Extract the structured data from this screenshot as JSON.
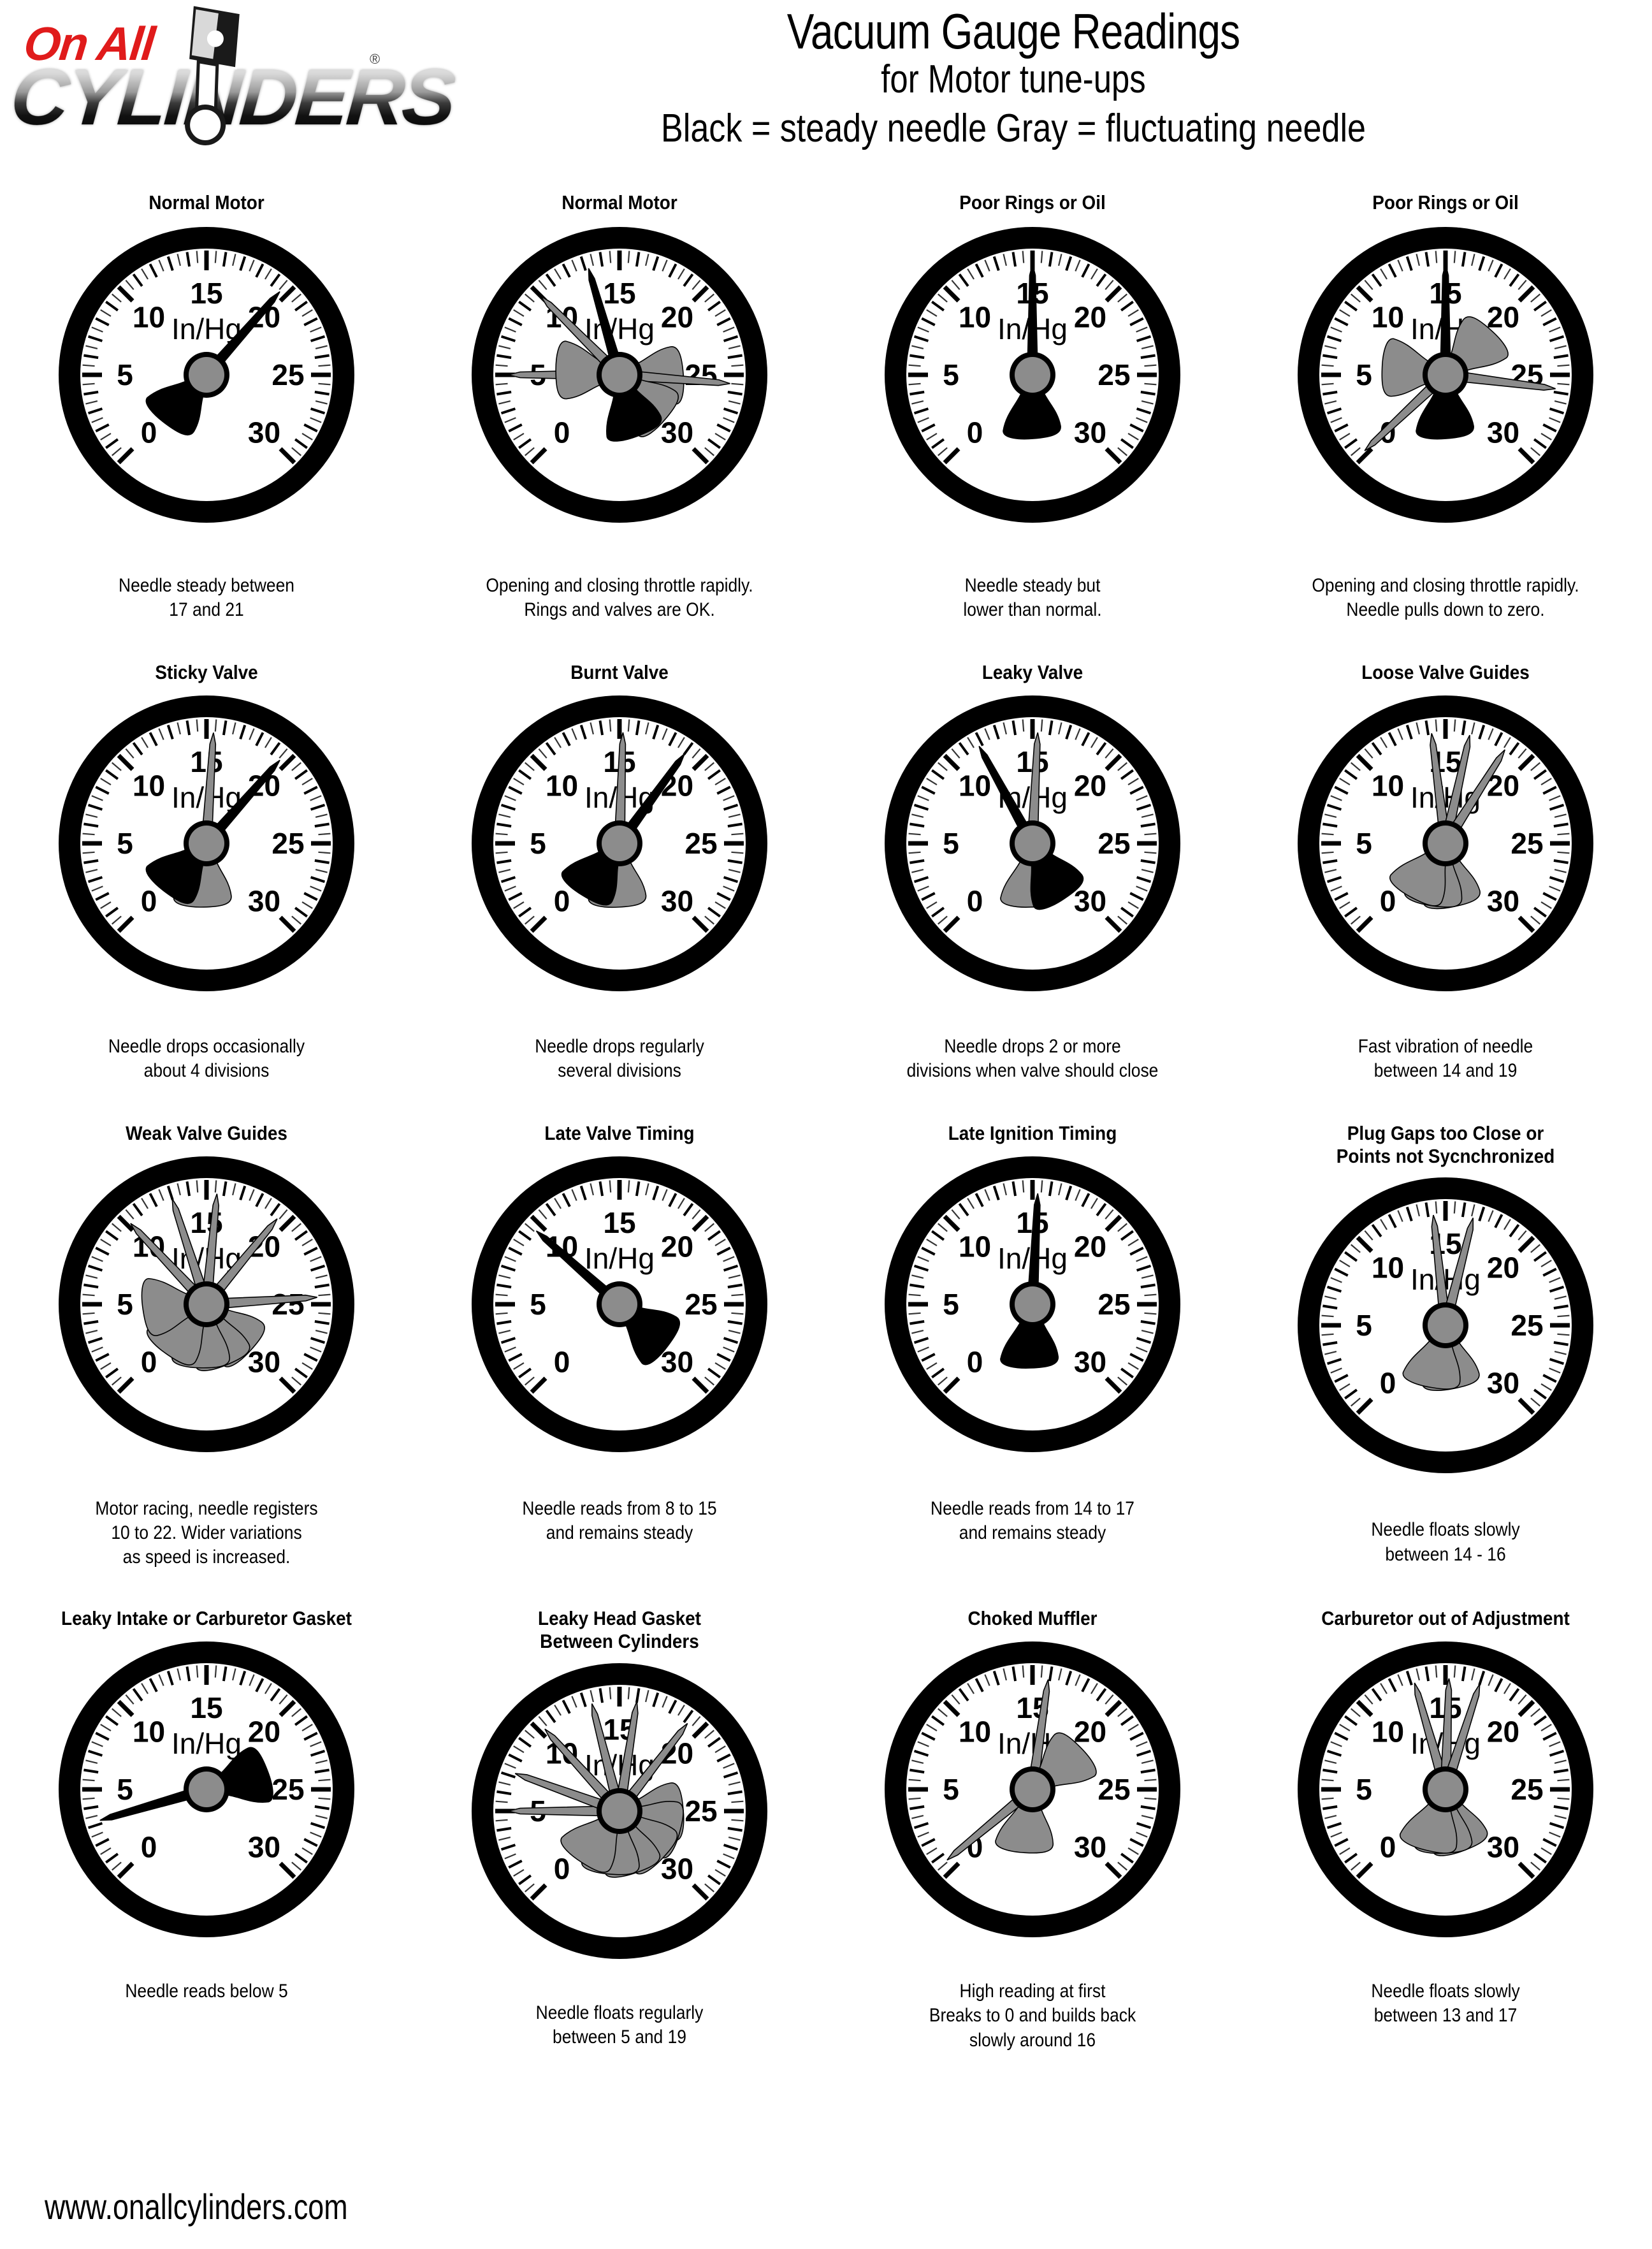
{
  "brand": {
    "logo_line1": "On All",
    "logo_line2": "CYLINDERS",
    "registered_mark": "®"
  },
  "header": {
    "title": "Vacuum Gauge Readings",
    "subtitle": "for Motor tune-ups",
    "legend": "Black = steady needle   Gray = fluctuating needle",
    "legend_black": "Black = steady needle",
    "legend_gray": "Gray = fluctuating needle"
  },
  "footer": {
    "website": "www.onallcylinders.com"
  },
  "gauge_face": {
    "unit_label": "In/Hg",
    "tick_labels": [
      "0",
      "5",
      "10",
      "15",
      "20",
      "25",
      "30"
    ],
    "scale_min": 0,
    "scale_max": 30,
    "bezel_color": "#000000",
    "face_color": "#ffffff",
    "steady_needle_color": "#000000",
    "fluctuating_needle_color": "#8c8c8c",
    "hub_color": "#8c8c8c"
  },
  "chart_data": {
    "type": "table",
    "title": "Vacuum Gauge Readings for Motor tune-ups",
    "legend": [
      "Black = steady needle",
      "Gray = fluctuating needle"
    ],
    "units": "In/Hg",
    "axis_range": [
      0,
      30
    ]
  },
  "gauges": [
    {
      "title": "Normal Motor",
      "caption": "Needle steady between\n17 and 21",
      "black": [
        19.6
      ],
      "gray": []
    },
    {
      "title": "Normal Motor",
      "caption": "Opening and closing throttle rapidly.\nRings and valves are OK.",
      "black": [
        13.2
      ],
      "gray": [
        5.0,
        25.5,
        10.0
      ]
    },
    {
      "title": "Poor Rings or Oil",
      "caption": "Needle steady but\nlower than normal.",
      "black": [
        15.0
      ],
      "gray": []
    },
    {
      "title": "Poor Rings or Oil",
      "caption": "Opening and closing throttle rapidly.\nNeedle pulls down to zero.",
      "black": [
        15.0
      ],
      "gray": [
        25.8,
        0.2
      ]
    },
    {
      "title": "Sticky Valve",
      "caption": "Needle drops occasionally\nabout 4 divisions",
      "black": [
        19.6
      ],
      "gray": [
        15.4
      ]
    },
    {
      "title": "Burnt Valve",
      "caption": "Needle drops regularly\nseveral divisions",
      "black": [
        19.0
      ],
      "gray": [
        15.2
      ]
    },
    {
      "title": "Leaky Valve",
      "caption": "Needle drops 2 or more\ndivisions when valve should close",
      "black": [
        11.8
      ],
      "gray": [
        15.3
      ]
    },
    {
      "title": "Loose Valve Guides",
      "caption": "Fast vibration of needle\nbetween 14 and 19",
      "black": [],
      "gray": [
        14.2,
        16.4,
        18.6
      ]
    },
    {
      "title": "Weak Valve Guides",
      "caption": "Motor racing, needle registers\n10 to 22.  Wider variations\nas speed is increased.",
      "black": [],
      "gray": [
        10.2,
        13.0,
        15.6,
        19.4,
        24.6
      ]
    },
    {
      "title": "Late Valve Timing",
      "caption": "Needle reads from 8 to 15\nand remains steady",
      "black": [
        9.6
      ],
      "gray": []
    },
    {
      "title": "Late Ignition Timing",
      "caption": "Needle reads from 14 to 17\nand remains steady",
      "black": [
        15.3
      ],
      "gray": []
    },
    {
      "title": "Plug Gaps too Close or\nPoints not Sycnchronized",
      "caption": "Needle floats slowly\nbetween 14 - 16",
      "black": [],
      "gray": [
        14.3,
        16.6
      ]
    },
    {
      "title": "Leaky Intake or Carburetor Gasket",
      "caption": "Needle reads below 5",
      "black": [
        3.2
      ],
      "gray": []
    },
    {
      "title": "Leaky Head Gasket\nBetween Cylinders",
      "caption": "Needle floats regularly\nbetween 5 and 19",
      "black": [],
      "gray": [
        5.0,
        7.2,
        10.3,
        13.4,
        16.0,
        19.2
      ]
    },
    {
      "title": "Choked Muffler",
      "caption": "High reading at first\nBreaks to 0 and builds back\nslowly around 16",
      "black": [],
      "gray": [
        15.9,
        0.6
      ]
    },
    {
      "title": "Carburetor out of Adjustment",
      "caption": "Needle floats slowly\nbetween 13 and 17",
      "black": [],
      "gray": [
        13.2,
        15.2,
        17.0
      ]
    }
  ]
}
